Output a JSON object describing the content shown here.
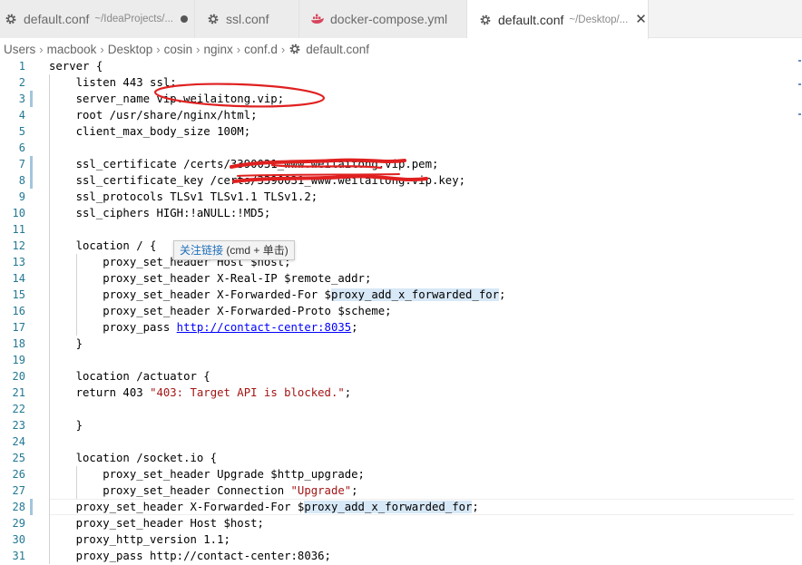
{
  "tabs": [
    {
      "name": "default.conf",
      "path": "~/IdeaProjects/...",
      "icon": "gear-icon",
      "dirty": true,
      "active": false
    },
    {
      "name": "ssl.conf",
      "path": "",
      "icon": "gear-icon",
      "dirty": false,
      "active": false
    },
    {
      "name": "docker-compose.yml",
      "path": "",
      "icon": "docker-icon",
      "dirty": false,
      "active": false
    },
    {
      "name": "default.conf",
      "path": "~/Desktop/...",
      "icon": "gear-icon",
      "dirty": false,
      "active": true,
      "close": "✕"
    }
  ],
  "breadcrumb": {
    "items": [
      "Users",
      "macbook",
      "Desktop",
      "cosin",
      "nginx",
      "conf.d"
    ],
    "separator": "›",
    "file": "default.conf",
    "file_icon": "gear-icon"
  },
  "editor": {
    "lines": [
      "server {",
      "    listen 443 ssl;",
      "    server_name vip.weilaitong.vip;",
      "    root /usr/share/nginx/html;",
      "    client_max_body_size 100M;",
      "",
      "    ssl_certificate /certs/3390031_www.weilaitong.vip.pem;",
      "    ssl_certificate_key /certs/3390031_www.weilaitong.vip.key;",
      "    ssl_protocols TLSv1 TLSv1.1 TLSv1.2;",
      "    ssl_ciphers HIGH:!aNULL:!MD5;",
      "",
      "    location / {",
      "        proxy_set_header Host $host;",
      "        proxy_set_header X-Real-IP $remote_addr;",
      "        proxy_set_header X-Forwarded-For $proxy_add_x_forwarded_for;",
      "        proxy_set_header X-Forwarded-Proto $scheme;",
      "        proxy_pass http://contact-center:8035;",
      "    }",
      "",
      "    location /actuator {",
      "    return 403 \"403: Target API is blocked.\";",
      "",
      "    }",
      "",
      "    location /socket.io {",
      "        proxy_set_header Upgrade $http_upgrade;",
      "        proxy_set_header Connection \"Upgrade\";",
      "    proxy_set_header X-Forwarded-For $proxy_add_x_forwarded_for;",
      "    proxy_set_header Host $host;",
      "    proxy_http_version 1.1;",
      "    proxy_pass http://contact-center:8036;"
    ],
    "modified_lines": [
      3,
      7,
      8,
      28
    ],
    "highlight_token": "proxy_add_x_forwarded_for",
    "link_token": "http://contact-center:8035",
    "current_line": 28
  },
  "tooltip": {
    "link_label": "关注链接",
    "hint": " (cmd + 单击)"
  },
  "colors": {
    "line_number": "#237893",
    "string": "#a31515",
    "link": "#0000ff",
    "word_highlight": "#d7e8f7",
    "annotation_red": "#e02020",
    "modified_gutter": "#a4c5dd"
  }
}
